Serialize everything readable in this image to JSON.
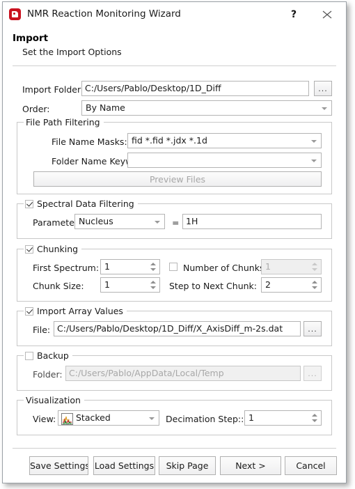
{
  "window": {
    "title": "NMR Reaction Monitoring Wizard",
    "app_icon": "mnova-logo-icon",
    "help_label": "?",
    "close_label": "close-icon"
  },
  "header": {
    "title": "Import",
    "subtitle": "Set the Import Options"
  },
  "import_folder": {
    "label": "Import Folder:",
    "value": "C:/Users/Pablo/Desktop/1D_Diff",
    "browse_label": "..."
  },
  "order": {
    "label": "Order:",
    "value": "By Name"
  },
  "file_path_filtering": {
    "title": "File Path Filtering",
    "file_name_masks": {
      "label": "File Name Masks:",
      "value": "fid *.fid *.jdx *.1d"
    },
    "folder_name_keywords": {
      "label": "Folder Name Keywords:",
      "value": ""
    },
    "preview_button": "Preview Files"
  },
  "spectral_data_filtering": {
    "title": "Spectral Data Filtering",
    "checked": true,
    "parameter_label": "Parameter",
    "parameter_value": "Nucleus",
    "equals": "=",
    "parameter_match": "1H"
  },
  "chunking": {
    "title": "Chunking",
    "checked": true,
    "first_spectrum": {
      "label": "First Spectrum:",
      "value": "1"
    },
    "number_of_chunks": {
      "label": "Number of Chunks:",
      "value": "1",
      "checked": false
    },
    "chunk_size": {
      "label": "Chunk Size:",
      "value": "1"
    },
    "step_to_next_chunk": {
      "label": "Step to Next Chunk:",
      "value": "2"
    }
  },
  "import_array_values": {
    "title": "Import Array Values",
    "checked": true,
    "file_label": "File:",
    "file_value": "C:/Users/Pablo/Desktop/1D_Diff/X_AxisDiff_m-2s.dat",
    "browse_label": "..."
  },
  "backup": {
    "title": "Backup",
    "checked": false,
    "folder_label": "Folder:",
    "folder_value": "C:/Users/Pablo/AppData/Local/Temp",
    "browse_label": "..."
  },
  "visualization": {
    "title": "Visualization",
    "view_label": "View:",
    "view_value": "Stacked",
    "view_icon": "stacked-spectra-icon",
    "decimation_label": "Decimation Step::",
    "decimation_value": "1"
  },
  "footer": {
    "buttons": [
      {
        "label": "Save Settings"
      },
      {
        "label": "Load Settings"
      },
      {
        "label": "Skip Page"
      },
      {
        "label": "Next >"
      },
      {
        "label": "Cancel"
      }
    ]
  },
  "colors": {
    "accent": "#c9111f",
    "border": "#c8c8c8",
    "field_border": "#b4b4b4",
    "disabled_text": "#a8a8a8"
  }
}
